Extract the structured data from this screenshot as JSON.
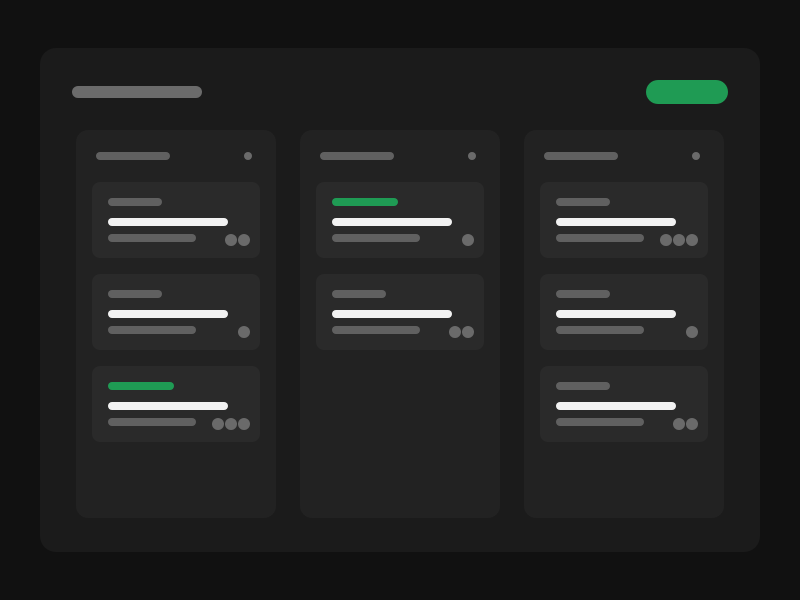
{
  "colors": {
    "page_bg": "#111111",
    "board_bg": "#1b1b1b",
    "column_bg": "#222222",
    "card_bg": "#2a2a2a",
    "accent": "#1f9b54",
    "placeholder": "#606060",
    "title_line": "#f2f2f2"
  },
  "header": {
    "title": "",
    "add_button_label": ""
  },
  "columns": [
    {
      "title": "",
      "cards": [
        {
          "tag": "",
          "tag_color": "gray",
          "title": "",
          "subtitle": "",
          "avatars": 2
        },
        {
          "tag": "",
          "tag_color": "gray",
          "title": "",
          "subtitle": "",
          "avatars": 1
        },
        {
          "tag": "",
          "tag_color": "green",
          "title": "",
          "subtitle": "",
          "avatars": 3
        }
      ]
    },
    {
      "title": "",
      "cards": [
        {
          "tag": "",
          "tag_color": "green",
          "title": "",
          "subtitle": "",
          "avatars": 1
        },
        {
          "tag": "",
          "tag_color": "gray",
          "title": "",
          "subtitle": "",
          "avatars": 2
        }
      ]
    },
    {
      "title": "",
      "cards": [
        {
          "tag": "",
          "tag_color": "gray",
          "title": "",
          "subtitle": "",
          "avatars": 3
        },
        {
          "tag": "",
          "tag_color": "gray",
          "title": "",
          "subtitle": "",
          "avatars": 1
        },
        {
          "tag": "",
          "tag_color": "gray",
          "title": "",
          "subtitle": "",
          "avatars": 2
        }
      ]
    }
  ]
}
